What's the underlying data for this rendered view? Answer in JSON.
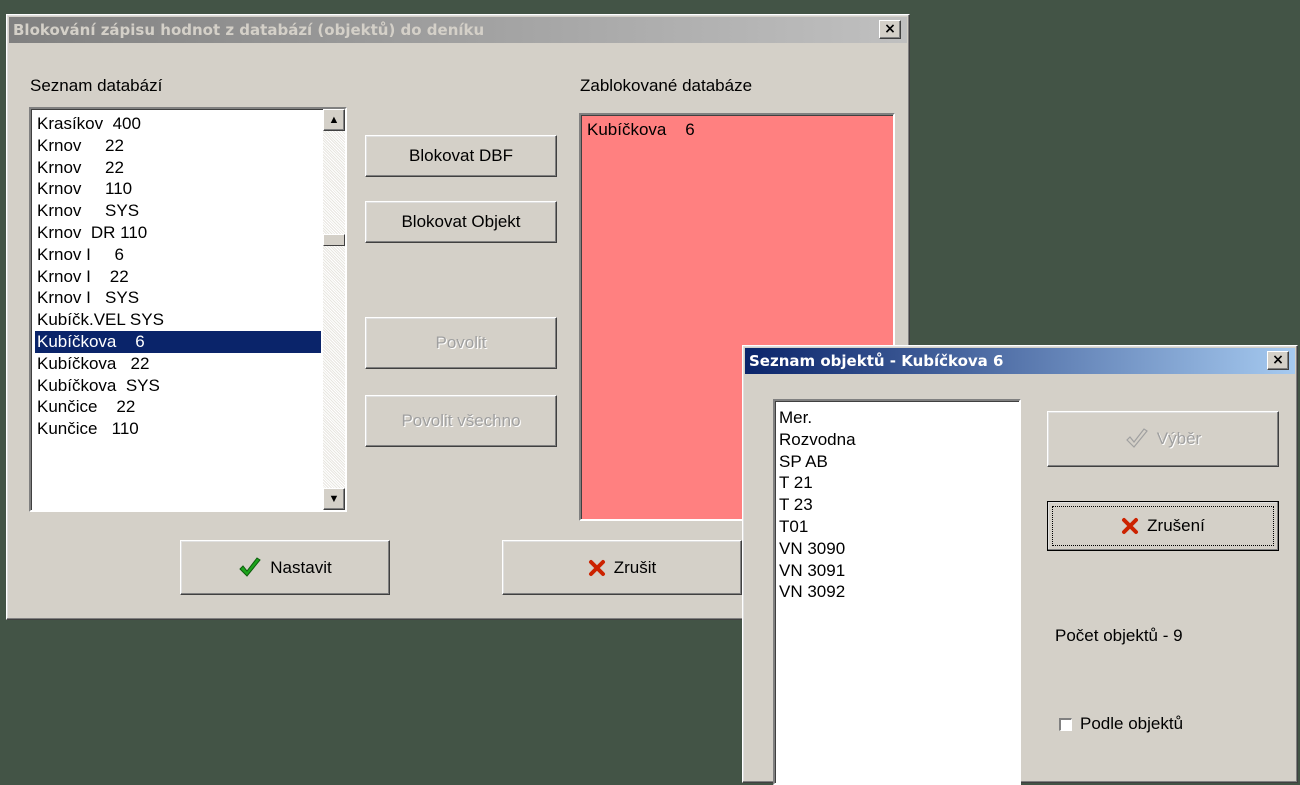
{
  "main_dialog": {
    "title": "Blokování zápisu hodnot z databází (objektů) do deníku",
    "close_label": "×",
    "database_list_label": "Seznam databází",
    "blocked_list_label": "Zablokované databáze",
    "database_list": [
      "Krasíkov  400",
      "Krnov     22",
      "Krnov     22",
      "Krnov     110",
      "Krnov     SYS",
      "Krnov  DR 110",
      "Krnov I     6",
      "Krnov I    22",
      "Krnov I   SYS",
      "Kubíčk.VEL SYS",
      "Kubíčkova    6",
      "Kubíčkova   22",
      "Kubíčkova  SYS",
      "Kunčice    22",
      "Kunčice   110"
    ],
    "selected_index": 10,
    "blocked_list": [
      "Kubíčkova    6"
    ],
    "buttons": {
      "block_dbf": "Blokovat DBF",
      "block_object": "Blokovat Objekt",
      "allow": "Povolit",
      "allow_all": "Povolit všechno",
      "ok": "Nastavit",
      "cancel": "Zrušit"
    }
  },
  "object_dialog": {
    "title": "Seznam objektů - Kubíčkova   6",
    "close_label": "×",
    "objects": [
      "Mer.",
      "Rozvodna",
      "SP AB",
      "T 21",
      "T 23",
      "T01",
      "VN 3090",
      "VN 3091",
      "VN 3092"
    ],
    "select_button": "Výběr",
    "cancel_button": "Zrušení",
    "count_text": "Počet objektů - 9",
    "by_objects_checkbox": "Podle objektů",
    "by_objects_checked": false
  }
}
